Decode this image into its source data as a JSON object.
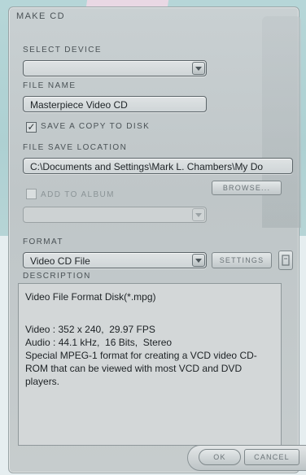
{
  "window": {
    "title": "Make CD"
  },
  "select_device": {
    "label": "Select Device",
    "value": ""
  },
  "file_name": {
    "label": "File Name",
    "value": "Masterpiece Video CD"
  },
  "save_copy": {
    "label": "Save A Copy To Disk",
    "checked": true,
    "mark": "✓"
  },
  "save_location": {
    "label": "File Save Location",
    "value": "C:\\Documents and Settings\\Mark L. Chambers\\My Do"
  },
  "add_album": {
    "label": "Add To Album",
    "checked": false
  },
  "browse_button": {
    "label": "Browse..."
  },
  "format": {
    "label": "Format",
    "value": "Video CD File"
  },
  "settings_button": {
    "label": "Settings"
  },
  "description": {
    "label": "Description",
    "lines": [
      "Video File Format Disk(*.mpg)",
      "",
      "Video : 352 x 240,  29.97 FPS",
      "Audio : 44.1 kHz,  16 Bits,  Stereo",
      "Special MPEG-1 format for creating a VCD video CD-ROM that can be viewed with most VCD and DVD players."
    ]
  },
  "ok_button": {
    "label": "Ok"
  },
  "cancel_button": {
    "label": "Cancel"
  }
}
